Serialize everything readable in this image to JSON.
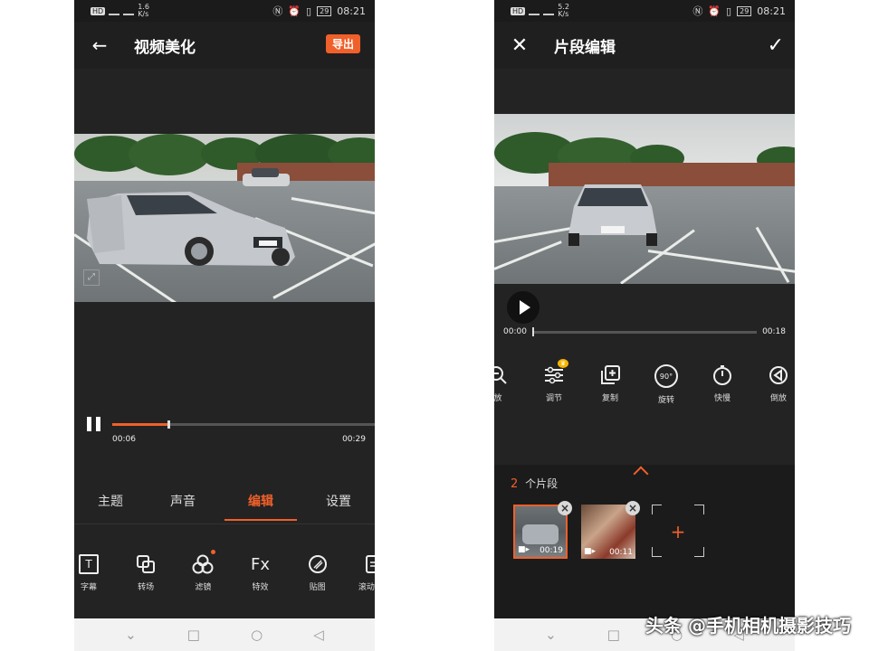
{
  "left": {
    "status": {
      "net": "HD",
      "speed": "1.6\nK/s",
      "battery": "29",
      "time": "08:21"
    },
    "title": "视频美化",
    "back_icon": "arrow-left-icon",
    "export_label": "导出",
    "player": {
      "current": "00:06",
      "total": "00:29",
      "progress": 0.21
    },
    "tabs": [
      {
        "label": "主题",
        "active": false
      },
      {
        "label": "声音",
        "active": false
      },
      {
        "label": "编辑",
        "active": true
      },
      {
        "label": "设置",
        "active": false
      }
    ],
    "tools": [
      {
        "label": "字幕",
        "icon": "text-icon"
      },
      {
        "label": "转场",
        "icon": "transition-icon"
      },
      {
        "label": "滤镜",
        "icon": "filter-icon"
      },
      {
        "label": "特效",
        "icon": "fx-icon",
        "glyph": "Fx"
      },
      {
        "label": "贴图",
        "icon": "sticker-icon"
      },
      {
        "label": "滚动字幕",
        "icon": "scroll-subtitle-icon"
      }
    ]
  },
  "right": {
    "status": {
      "net": "HD",
      "speed": "5.2\nK/s",
      "battery": "29",
      "time": "08:21"
    },
    "title": "片段编辑",
    "player": {
      "current": "00:00",
      "total": "00:18",
      "progress": 0.0
    },
    "tools": [
      {
        "label": "放",
        "icon": "zoom-icon"
      },
      {
        "label": "调节",
        "icon": "adjust-icon"
      },
      {
        "label": "复制",
        "icon": "copy-icon"
      },
      {
        "label": "旋转",
        "icon": "rotate-icon",
        "glyph": "90°"
      },
      {
        "label": "快慢",
        "icon": "speed-icon"
      },
      {
        "label": "倒放",
        "icon": "reverse-icon"
      }
    ],
    "clips_count": "2",
    "clips_label": "个片段",
    "clips": [
      {
        "duration": "00:19",
        "selected": true
      },
      {
        "duration": "00:11",
        "selected": false
      }
    ]
  },
  "watermark": "头条 @手机相机摄影技巧",
  "colors": {
    "accent": "#f0602a",
    "bg": "#232323",
    "crown": "#f7b500"
  }
}
